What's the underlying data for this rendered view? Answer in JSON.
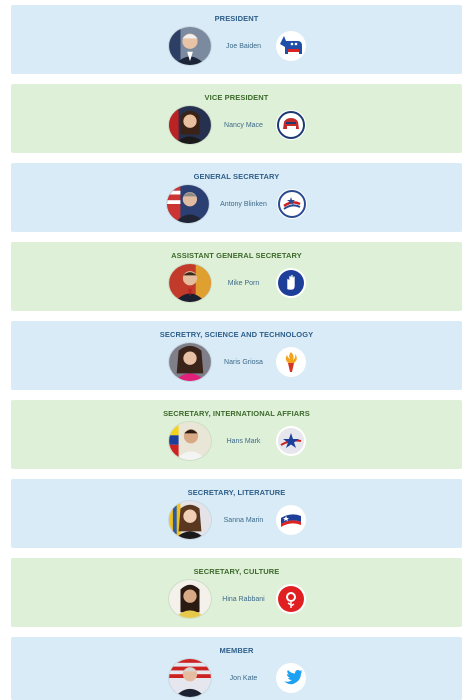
{
  "members": [
    {
      "role": "PRESIDENT",
      "name": "Joe Baiden",
      "logo": "donkey-icon",
      "theme": "blue"
    },
    {
      "role": "VICE PRESIDENT",
      "name": "Nancy Mace",
      "logo": "elephant-icon",
      "theme": "green"
    },
    {
      "role": "GENERAL SECRETARY",
      "name": "Antony Blinken",
      "logo": "star-swoosh-icon",
      "theme": "blue"
    },
    {
      "role": "ASSISTANT GENERAL SECRETARY",
      "name": "Mike Porn",
      "logo": "hand-icon",
      "theme": "green"
    },
    {
      "role": "SECRETRY, SCIENCE AND TECHNOLOGY",
      "name": "Naris Griosa",
      "logo": "torch-icon",
      "theme": "blue"
    },
    {
      "role": "SECRETARY, INTERNATIONAL AFFIARS",
      "name": "Hans Mark",
      "logo": "star-icon",
      "theme": "green"
    },
    {
      "role": "SECRETARY, LITERATURE",
      "name": "Sanna Marin",
      "logo": "flag-wave-icon",
      "theme": "blue"
    },
    {
      "role": "SECRETARY, CULTURE",
      "name": "Hina Rabbani",
      "logo": "rose-icon",
      "theme": "green"
    },
    {
      "role": "MEMBER",
      "name": "Jon Kate",
      "logo": "twitter-bird-icon",
      "theme": "blue"
    }
  ],
  "colors": {
    "blue_card": "#d9ebf6",
    "green_card": "#dff0d8",
    "blue_title": "#2f5f8a",
    "green_title": "#3d6a2c"
  }
}
